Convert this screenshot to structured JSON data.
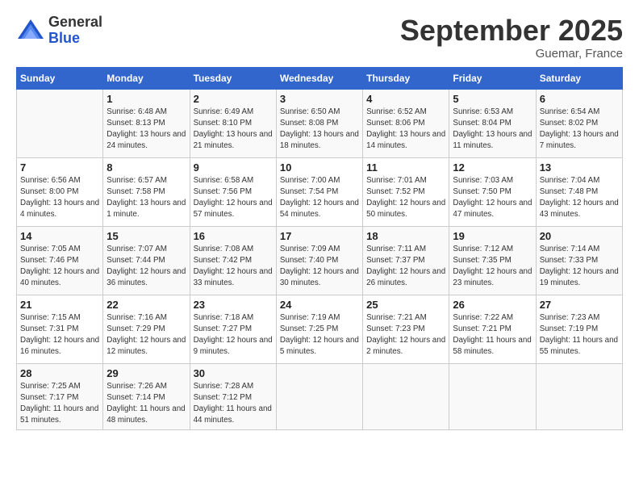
{
  "logo": {
    "general": "General",
    "blue": "Blue"
  },
  "title": "September 2025",
  "subtitle": "Guemar, France",
  "days_of_week": [
    "Sunday",
    "Monday",
    "Tuesday",
    "Wednesday",
    "Thursday",
    "Friday",
    "Saturday"
  ],
  "weeks": [
    [
      {
        "day": "",
        "info": ""
      },
      {
        "day": "1",
        "info": "Sunrise: 6:48 AM\nSunset: 8:13 PM\nDaylight: 13 hours\nand 24 minutes."
      },
      {
        "day": "2",
        "info": "Sunrise: 6:49 AM\nSunset: 8:10 PM\nDaylight: 13 hours\nand 21 minutes."
      },
      {
        "day": "3",
        "info": "Sunrise: 6:50 AM\nSunset: 8:08 PM\nDaylight: 13 hours\nand 18 minutes."
      },
      {
        "day": "4",
        "info": "Sunrise: 6:52 AM\nSunset: 8:06 PM\nDaylight: 13 hours\nand 14 minutes."
      },
      {
        "day": "5",
        "info": "Sunrise: 6:53 AM\nSunset: 8:04 PM\nDaylight: 13 hours\nand 11 minutes."
      },
      {
        "day": "6",
        "info": "Sunrise: 6:54 AM\nSunset: 8:02 PM\nDaylight: 13 hours\nand 7 minutes."
      }
    ],
    [
      {
        "day": "7",
        "info": "Sunrise: 6:56 AM\nSunset: 8:00 PM\nDaylight: 13 hours\nand 4 minutes."
      },
      {
        "day": "8",
        "info": "Sunrise: 6:57 AM\nSunset: 7:58 PM\nDaylight: 13 hours\nand 1 minute."
      },
      {
        "day": "9",
        "info": "Sunrise: 6:58 AM\nSunset: 7:56 PM\nDaylight: 12 hours\nand 57 minutes."
      },
      {
        "day": "10",
        "info": "Sunrise: 7:00 AM\nSunset: 7:54 PM\nDaylight: 12 hours\nand 54 minutes."
      },
      {
        "day": "11",
        "info": "Sunrise: 7:01 AM\nSunset: 7:52 PM\nDaylight: 12 hours\nand 50 minutes."
      },
      {
        "day": "12",
        "info": "Sunrise: 7:03 AM\nSunset: 7:50 PM\nDaylight: 12 hours\nand 47 minutes."
      },
      {
        "day": "13",
        "info": "Sunrise: 7:04 AM\nSunset: 7:48 PM\nDaylight: 12 hours\nand 43 minutes."
      }
    ],
    [
      {
        "day": "14",
        "info": "Sunrise: 7:05 AM\nSunset: 7:46 PM\nDaylight: 12 hours\nand 40 minutes."
      },
      {
        "day": "15",
        "info": "Sunrise: 7:07 AM\nSunset: 7:44 PM\nDaylight: 12 hours\nand 36 minutes."
      },
      {
        "day": "16",
        "info": "Sunrise: 7:08 AM\nSunset: 7:42 PM\nDaylight: 12 hours\nand 33 minutes."
      },
      {
        "day": "17",
        "info": "Sunrise: 7:09 AM\nSunset: 7:40 PM\nDaylight: 12 hours\nand 30 minutes."
      },
      {
        "day": "18",
        "info": "Sunrise: 7:11 AM\nSunset: 7:37 PM\nDaylight: 12 hours\nand 26 minutes."
      },
      {
        "day": "19",
        "info": "Sunrise: 7:12 AM\nSunset: 7:35 PM\nDaylight: 12 hours\nand 23 minutes."
      },
      {
        "day": "20",
        "info": "Sunrise: 7:14 AM\nSunset: 7:33 PM\nDaylight: 12 hours\nand 19 minutes."
      }
    ],
    [
      {
        "day": "21",
        "info": "Sunrise: 7:15 AM\nSunset: 7:31 PM\nDaylight: 12 hours\nand 16 minutes."
      },
      {
        "day": "22",
        "info": "Sunrise: 7:16 AM\nSunset: 7:29 PM\nDaylight: 12 hours\nand 12 minutes."
      },
      {
        "day": "23",
        "info": "Sunrise: 7:18 AM\nSunset: 7:27 PM\nDaylight: 12 hours\nand 9 minutes."
      },
      {
        "day": "24",
        "info": "Sunrise: 7:19 AM\nSunset: 7:25 PM\nDaylight: 12 hours\nand 5 minutes."
      },
      {
        "day": "25",
        "info": "Sunrise: 7:21 AM\nSunset: 7:23 PM\nDaylight: 12 hours\nand 2 minutes."
      },
      {
        "day": "26",
        "info": "Sunrise: 7:22 AM\nSunset: 7:21 PM\nDaylight: 11 hours\nand 58 minutes."
      },
      {
        "day": "27",
        "info": "Sunrise: 7:23 AM\nSunset: 7:19 PM\nDaylight: 11 hours\nand 55 minutes."
      }
    ],
    [
      {
        "day": "28",
        "info": "Sunrise: 7:25 AM\nSunset: 7:17 PM\nDaylight: 11 hours\nand 51 minutes."
      },
      {
        "day": "29",
        "info": "Sunrise: 7:26 AM\nSunset: 7:14 PM\nDaylight: 11 hours\nand 48 minutes."
      },
      {
        "day": "30",
        "info": "Sunrise: 7:28 AM\nSunset: 7:12 PM\nDaylight: 11 hours\nand 44 minutes."
      },
      {
        "day": "",
        "info": ""
      },
      {
        "day": "",
        "info": ""
      },
      {
        "day": "",
        "info": ""
      },
      {
        "day": "",
        "info": ""
      }
    ]
  ]
}
